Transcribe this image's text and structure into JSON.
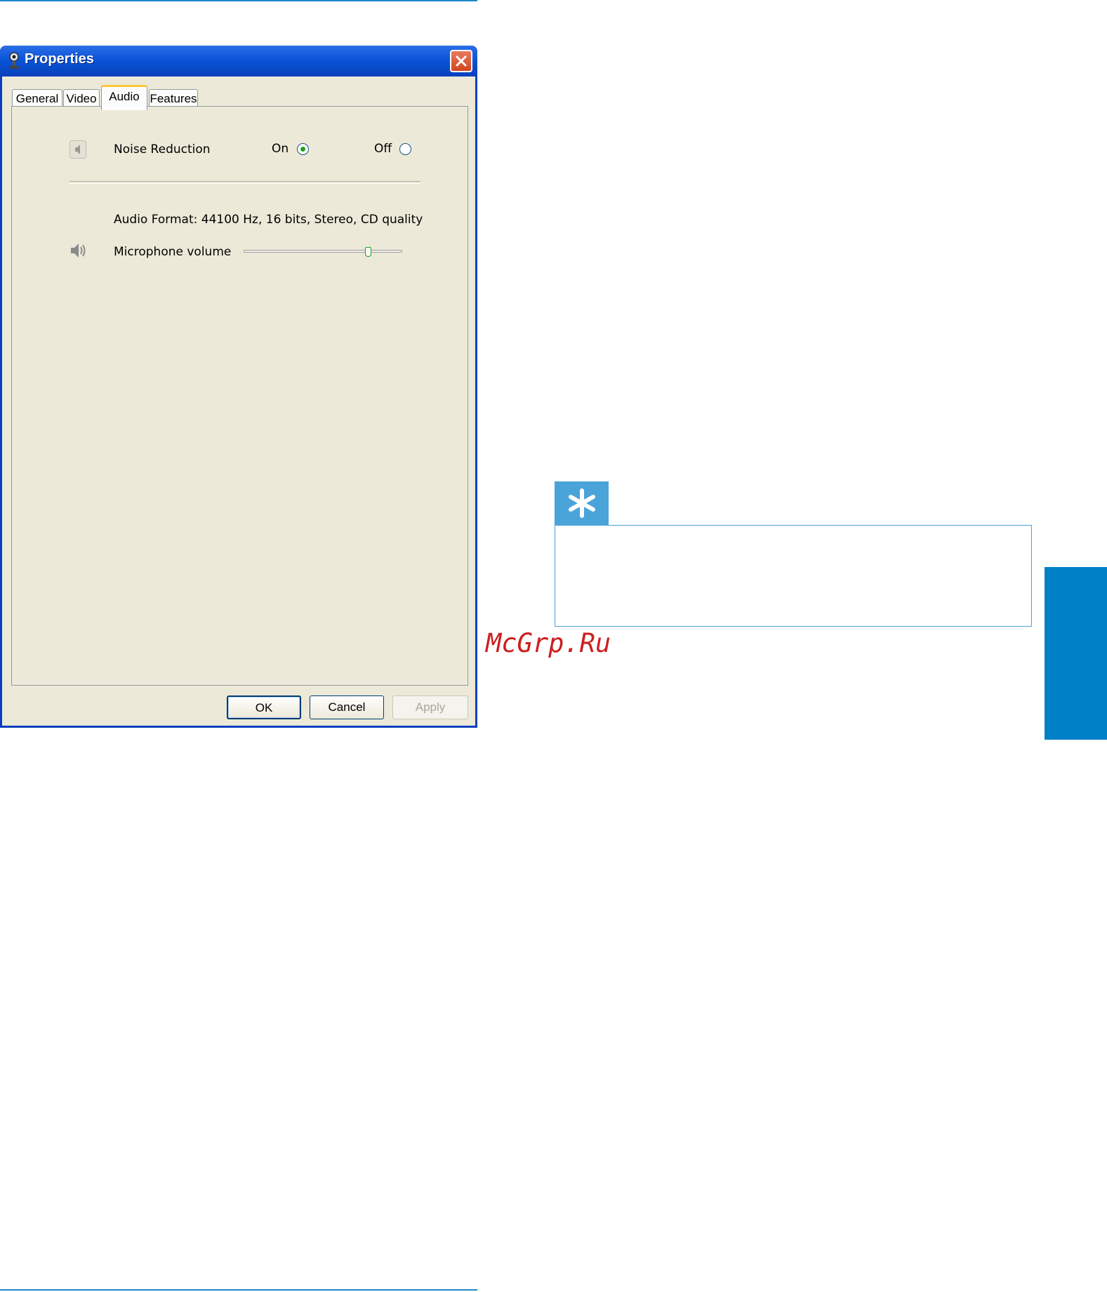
{
  "window": {
    "title": "Properties"
  },
  "tabs": [
    {
      "label": "General",
      "active": false
    },
    {
      "label": "Video",
      "active": false
    },
    {
      "label": "Audio",
      "active": true
    },
    {
      "label": "Features",
      "active": false
    }
  ],
  "audio": {
    "noise_reduction_label": "Noise Reduction",
    "on_label": "On",
    "off_label": "Off",
    "noise_reduction_selected": "On",
    "format_text": "Audio Format: 44100 Hz, 16 bits, Stereo, CD quality",
    "mic_volume_label": "Microphone volume",
    "mic_volume_fraction": 0.8
  },
  "buttons": {
    "ok": "OK",
    "cancel": "Cancel",
    "apply": "Apply"
  },
  "watermark": "McGrp.Ru",
  "colors": {
    "accent": "#1e87c8",
    "tip": "#4aa3d9",
    "side_tab": "#0080c7",
    "xp_title": "#0a54d9"
  }
}
